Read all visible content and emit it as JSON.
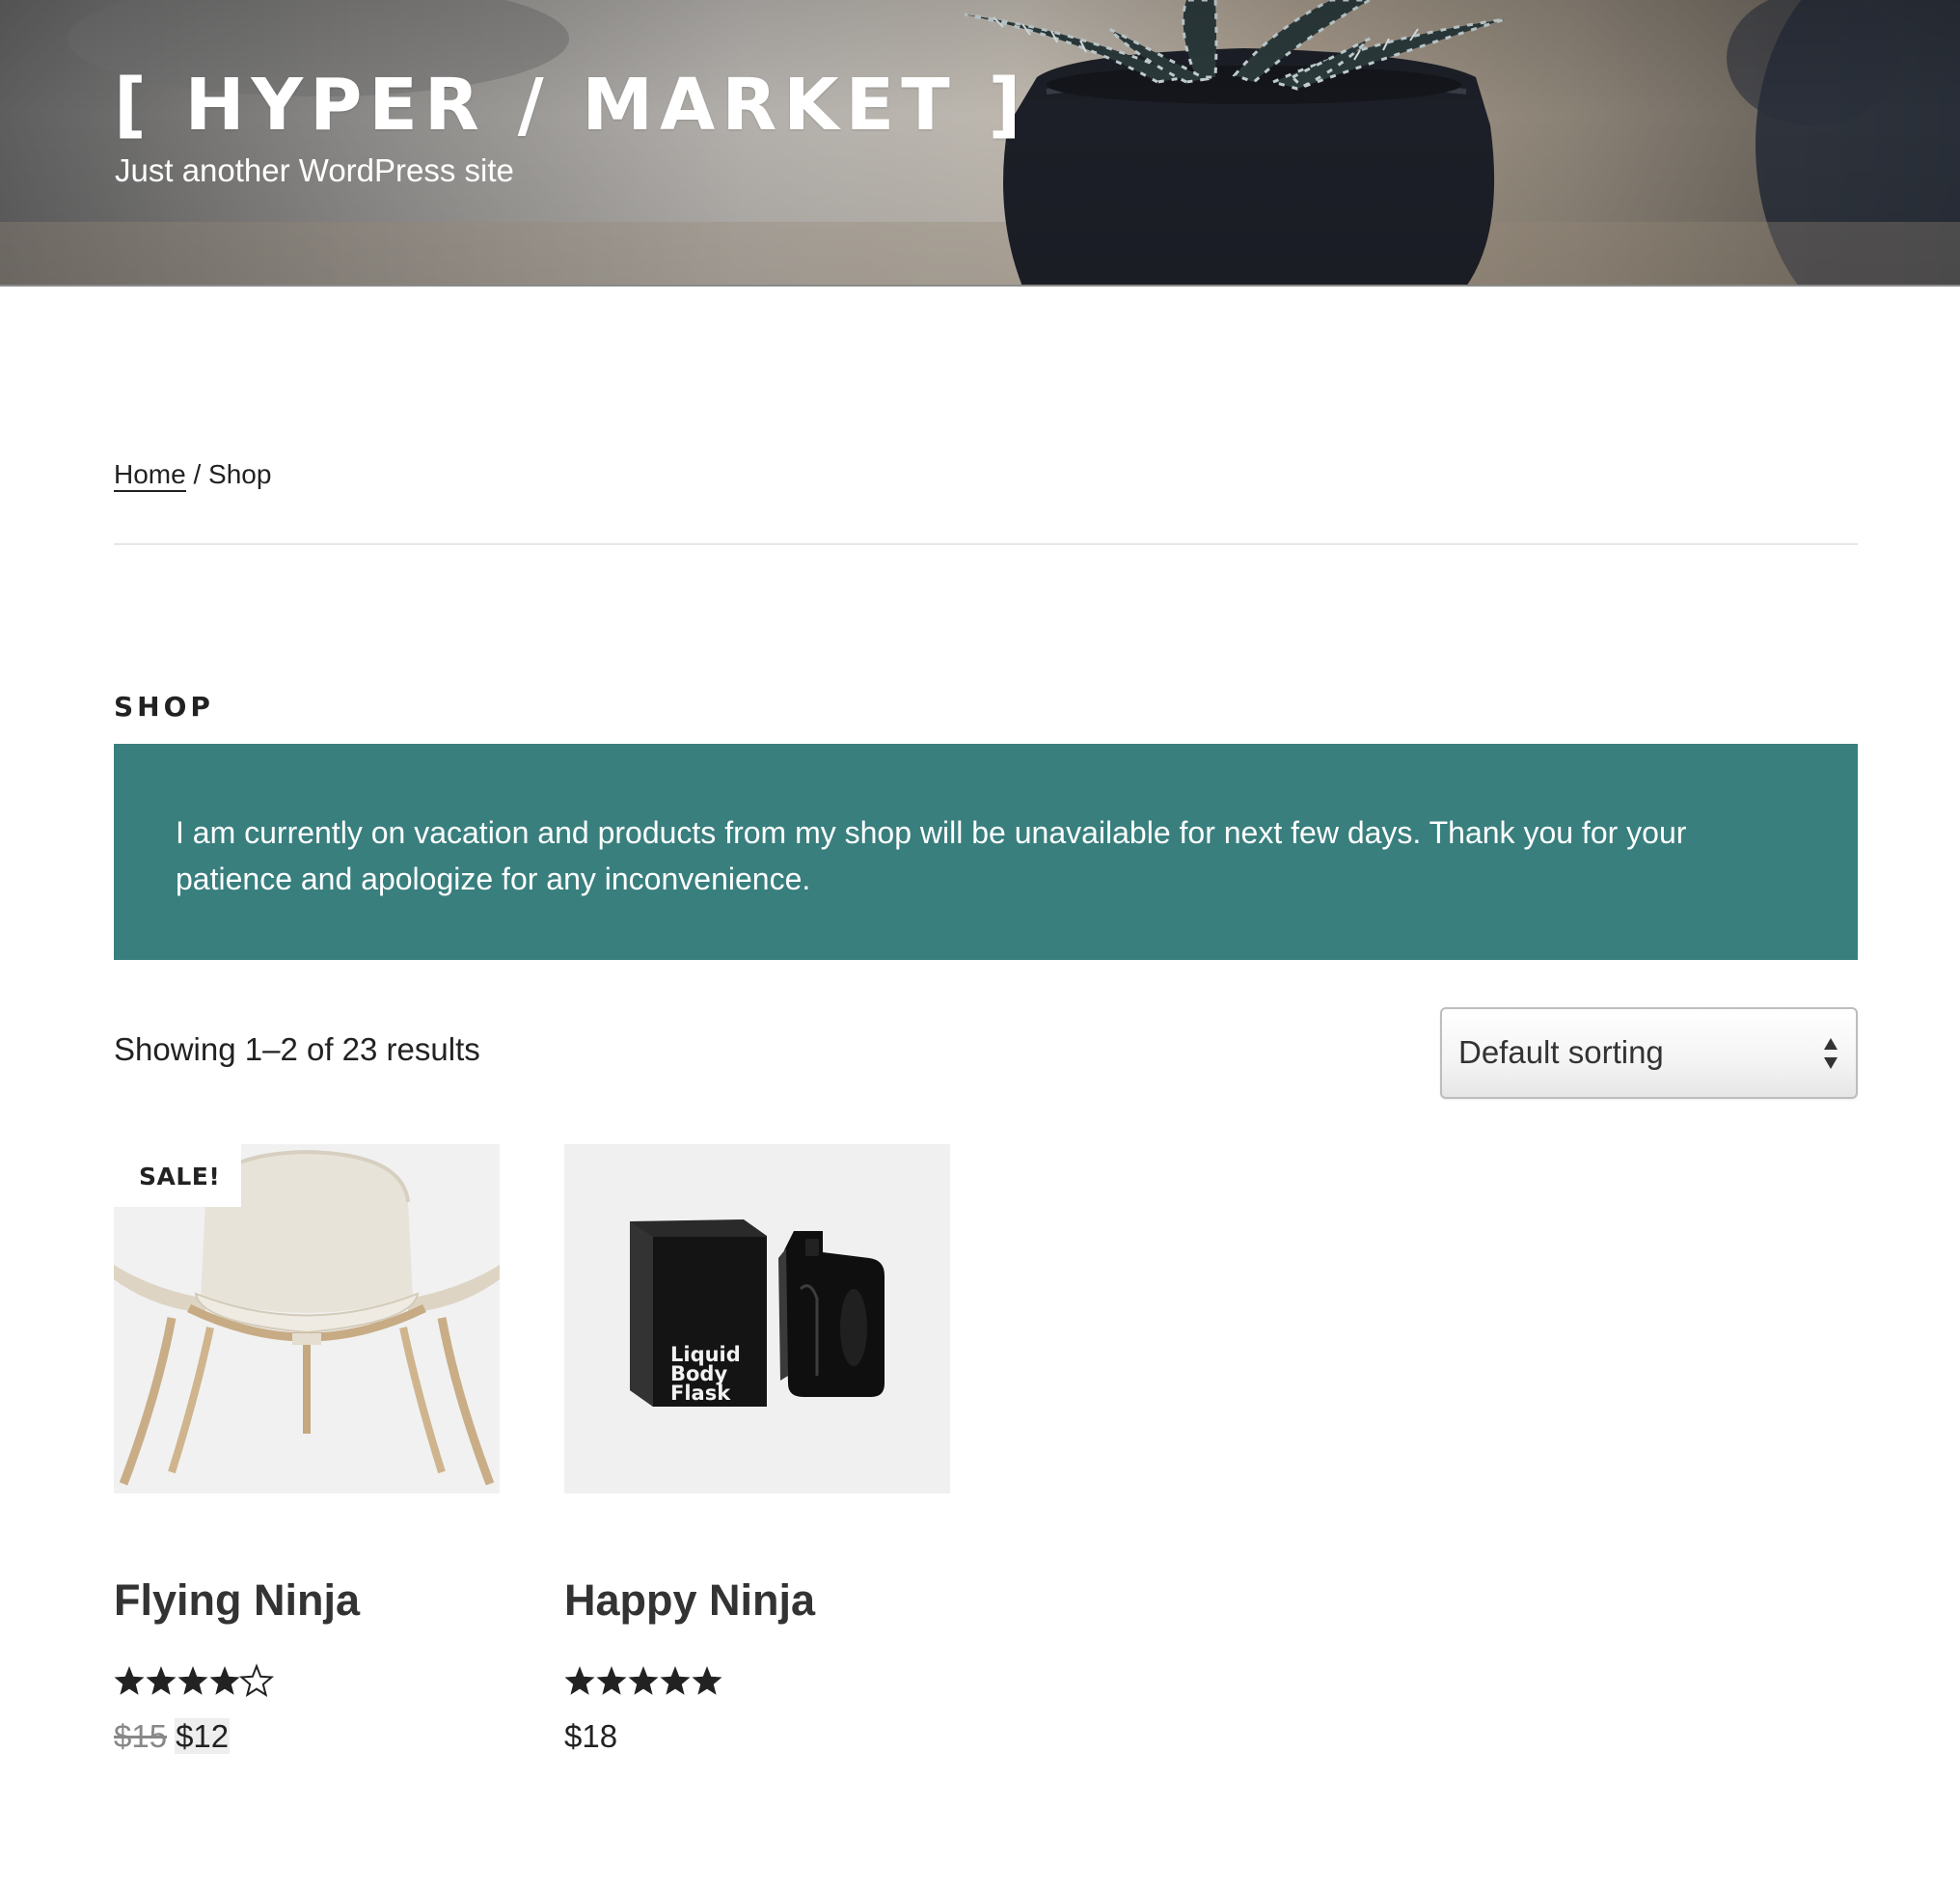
{
  "header": {
    "site_title": "[ HYPER / MARKET ]",
    "tagline": "Just another WordPress site"
  },
  "breadcrumb": {
    "home_label": "Home",
    "separator": " / ",
    "current": "Shop"
  },
  "page": {
    "title": "SHOP"
  },
  "notice": {
    "text": "I am currently on vacation and products from my shop will be unavailable for next few days. Thank you for your patience and apologize for any inconvenience.",
    "background_color": "#387f7e"
  },
  "results": {
    "count_text": "Showing 1–2 of 23 results",
    "ordering_selected": "Default sorting"
  },
  "products": [
    {
      "name": "Flying Ninja",
      "badge": "SALE!",
      "rating": 4,
      "rating_max": 5,
      "price_regular": "$15",
      "price_sale": "$12",
      "image_icon": "lounge-chair-image"
    },
    {
      "name": "Happy Ninja",
      "rating": 5,
      "rating_max": 5,
      "price": "$18",
      "image_icon": "flask-product-image",
      "image_text": [
        "Liquid",
        "Body",
        "Flask"
      ]
    }
  ]
}
